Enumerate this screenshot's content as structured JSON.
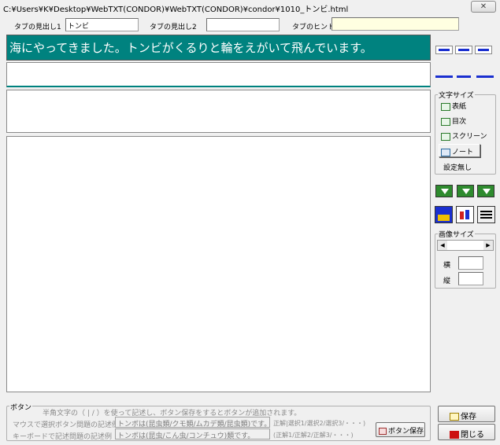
{
  "window": {
    "title": "C:¥Users¥K¥Desktop¥WebTXT(CONDOR)¥WebTXT(CONDOR)¥condor¥1010_トンビ.html",
    "close_label": "✕"
  },
  "tabs": {
    "heading1_label": "タブの見出し1",
    "heading1_value": "トンビ",
    "heading2_label": "タブの見出し2",
    "heading2_value": "",
    "hint_label": "タブのヒント",
    "hint_value": ""
  },
  "banner_text": "海にやってきました。トンビがくるりと輪をえがいて飛んでいます。",
  "font_size_group": {
    "title": "文字サイズ",
    "options": [
      {
        "label": "表紙",
        "icon": "cover-icon"
      },
      {
        "label": "目次",
        "icon": "toc-icon"
      },
      {
        "label": "スクリーン",
        "icon": "screen-icon"
      },
      {
        "label": "ノート",
        "icon": "note-icon"
      }
    ],
    "none_label": "設定無し"
  },
  "image_size_group": {
    "title": "画像サイズ",
    "width_label": "横",
    "height_label": "縦",
    "width_value": "",
    "height_value": ""
  },
  "button_group": {
    "title": "ボタン",
    "hint": "半角文字の（ | / ）を使って記述し、ボタン保存をするとボタンが追加されます。",
    "mouse_label": "マウスで選択ボタン問題の記述例",
    "mouse_example": "トンボは(昆虫類/クモ類/ムカデ類/昆虫類)です。",
    "mouse_note": "正解|選択1/選択2/選択3/・・・)",
    "keyboard_label": "キーボードで記述問題の記述例",
    "keyboard_example": "トンボは(昆虫/こん虫/コンチュウ)類です。",
    "keyboard_note": "(正解1/正解2/正解3/・・・)",
    "save_button_label": "ボタン保存"
  },
  "actions": {
    "save_label": "保存",
    "close_label": "閉じる"
  },
  "colors": {
    "banner_bg": "#00827f",
    "hint_bg": "#ffffe1",
    "accent_blue": "#1a2fd0",
    "accent_green": "#2e8b2e",
    "close_red": "#cc1010"
  }
}
